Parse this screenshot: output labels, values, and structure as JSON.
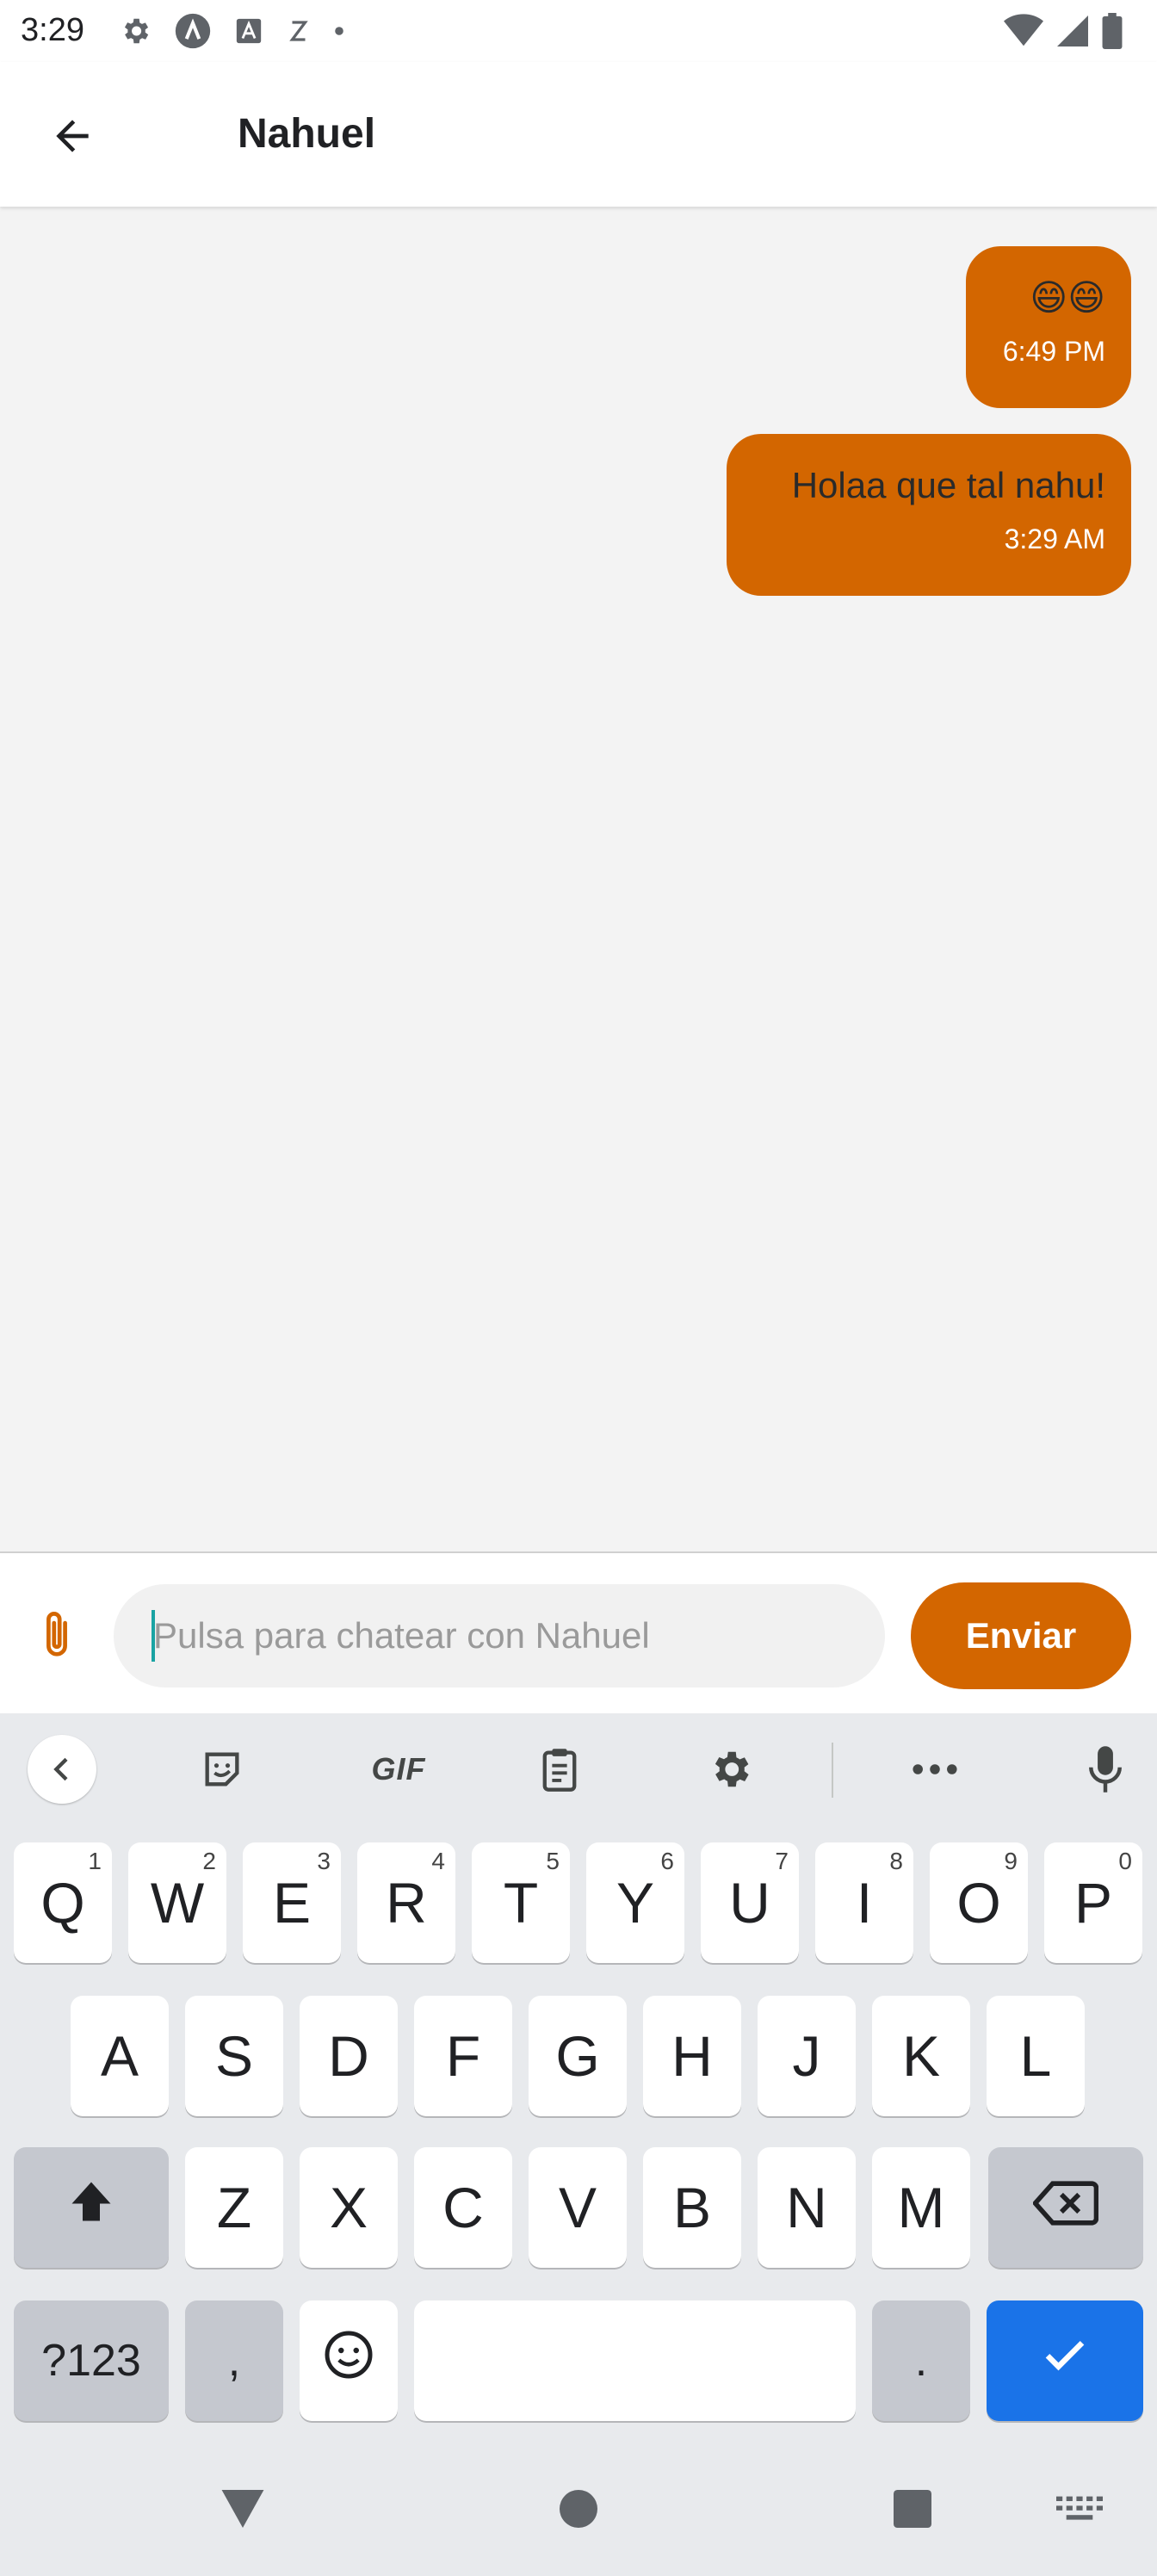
{
  "status_bar": {
    "time": "3:29",
    "icons_left": [
      "settings-icon",
      "android-studio-icon",
      "font-icon",
      "doze-icon",
      "dot-icon"
    ],
    "icons_right": [
      "wifi-icon",
      "signal-icon",
      "battery-icon"
    ]
  },
  "app_bar": {
    "back_icon": "arrow-back-icon",
    "title": "Nahuel"
  },
  "messages": [
    {
      "text": "😄😄",
      "time": "6:49 PM",
      "sender": "me"
    },
    {
      "text": "Holaa que tal nahu!",
      "time": "3:29 AM",
      "sender": "me"
    }
  ],
  "composer": {
    "attach_icon": "paperclip-icon",
    "input_value": "",
    "placeholder": "Pulsa para chatear con Nahuel",
    "send_label": "Enviar"
  },
  "keyboard": {
    "toolbar": {
      "items": [
        "chevron-left-icon",
        "sticker-icon",
        "GIF",
        "clipboard-icon",
        "gear-icon",
        "more-icon",
        "mic-icon"
      ]
    },
    "row1": [
      {
        "key": "Q",
        "hint": "1"
      },
      {
        "key": "W",
        "hint": "2"
      },
      {
        "key": "E",
        "hint": "3"
      },
      {
        "key": "R",
        "hint": "4"
      },
      {
        "key": "T",
        "hint": "5"
      },
      {
        "key": "Y",
        "hint": "6"
      },
      {
        "key": "U",
        "hint": "7"
      },
      {
        "key": "I",
        "hint": "8"
      },
      {
        "key": "O",
        "hint": "9"
      },
      {
        "key": "P",
        "hint": "0"
      }
    ],
    "row2": [
      "A",
      "S",
      "D",
      "F",
      "G",
      "H",
      "J",
      "K",
      "L"
    ],
    "row3": [
      "Z",
      "X",
      "C",
      "V",
      "B",
      "N",
      "M"
    ],
    "row4": {
      "symbols_label": "?123",
      "comma_label": ",",
      "period_label": "."
    }
  },
  "nav_bar": {
    "items": [
      "back-triangle-icon",
      "home-circle-icon",
      "recents-square-icon",
      "keyboard-switch-icon"
    ]
  },
  "colors": {
    "accent": "#d36600",
    "keyboard_bg": "#e8eaed",
    "enter_key": "#1a73e8",
    "chat_bg": "#f3f3f3"
  }
}
